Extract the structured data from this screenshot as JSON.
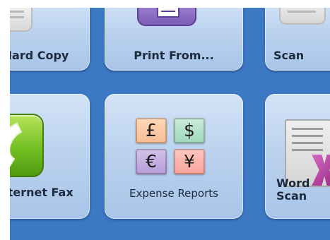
{
  "tiles": {
    "copy": {
      "label": "Hard Copy"
    },
    "print": {
      "label": "Print From..."
    },
    "scan": {
      "label": "Scan"
    },
    "fax": {
      "label": "Internet Fax"
    },
    "expense": {
      "label": "Expense Reports",
      "currencies": {
        "gbp": "£",
        "usd": "$",
        "eur": "€",
        "jpy": "¥"
      }
    },
    "word": {
      "label_line1": "Word",
      "label_line2": "Scan"
    }
  },
  "icons": {
    "copy": "copy-icon",
    "print": "print-icon",
    "scan": "scan-icon",
    "fax": "fax-phone-icon",
    "expense": "currency-icon",
    "word": "word-document-icon"
  },
  "colors": {
    "screen_background": "#3c78c4",
    "tile_background": "#bcd3ef",
    "label_text": "#1c2a3e",
    "fax_green": "#6fbc20",
    "print_purple": "#7c5cb8"
  }
}
